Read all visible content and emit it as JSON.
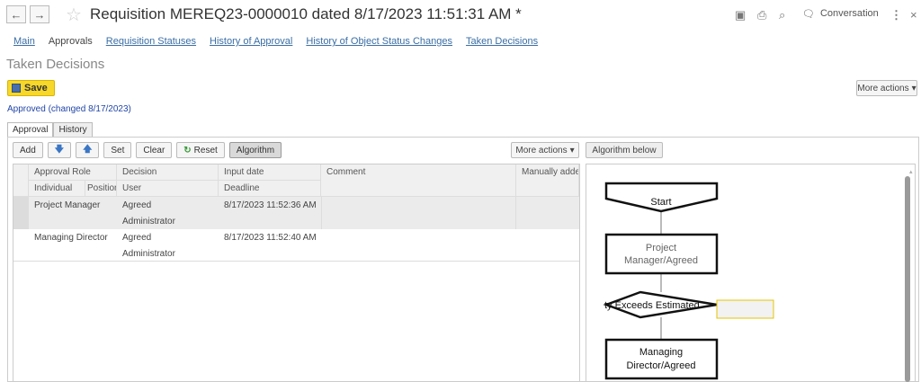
{
  "window": {
    "title": "Requisition MEREQ23-0000010 dated 8/17/2023 11:51:31 AM *",
    "back_icon": "←",
    "forward_icon": "→",
    "conversation_label": "Conversation",
    "menu_icon": "⋮",
    "close_icon": "×"
  },
  "nav_tabs": [
    {
      "label": "Main"
    },
    {
      "label": "Approvals"
    },
    {
      "label": "Requisition Statuses"
    },
    {
      "label": "History of Approval"
    },
    {
      "label": "History of Object Status Changes"
    },
    {
      "label": "Taken Decisions"
    }
  ],
  "section_title": "Taken Decisions",
  "save_label": "Save",
  "more_actions_label": "More actions",
  "approved_text": "Approved (changed 8/17/2023)",
  "panel_tabs": [
    {
      "label": "Approval"
    },
    {
      "label": "History"
    }
  ],
  "toolbar": {
    "add": "Add",
    "set": "Set",
    "clear": "Clear",
    "reset": "Reset",
    "algorithm": "Algorithm",
    "more_actions": "More actions",
    "algorithm_below": "Algorithm below"
  },
  "table": {
    "headers_row1": [
      "Approval Role",
      "Decision",
      "Input date",
      "Comment",
      "Manually added"
    ],
    "headers_row2": [
      "Individual",
      "Position",
      "User",
      "Deadline"
    ],
    "rows": [
      {
        "role": "Project Manager",
        "decision": "Agreed",
        "date": "8/17/2023 11:52:36 AM",
        "user": "Administrator"
      },
      {
        "role": "Managing Director",
        "decision": "Agreed",
        "date": "8/17/2023 11:52:40 AM",
        "user": "Administrator"
      }
    ]
  },
  "flowchart": {
    "start": "Start",
    "node1_line1": "Project",
    "node1_line2": "Manager/Agreed",
    "decision": "ty Exceeds Estimated",
    "node2_line1": "Managing",
    "node2_line2": "Director/Agreed"
  }
}
